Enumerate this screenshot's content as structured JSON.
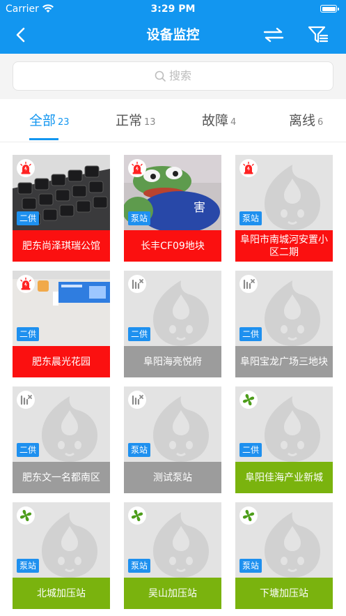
{
  "status_bar": {
    "carrier": "Carrier",
    "time": "3:29 PM"
  },
  "nav": {
    "title": "设备监控"
  },
  "search": {
    "placeholder": "搜索"
  },
  "tabs": [
    {
      "label": "全部",
      "count": "23"
    },
    {
      "label": "正常",
      "count": "13"
    },
    {
      "label": "故障",
      "count": "4"
    },
    {
      "label": "离线",
      "count": "6"
    }
  ],
  "colors": {
    "primary": "#1296f0",
    "alarm_red": "#fb1010",
    "offline_gray": "#9c9c9c",
    "normal_green": "#7ab30e",
    "badge_blue": "#1e90ef"
  },
  "devices": [
    {
      "name": "肥东尚泽琪瑞公馆",
      "type": "二供",
      "state": "alarm",
      "image": "keyboard-photo"
    },
    {
      "name": "长丰CF09地块",
      "type": "泵站",
      "state": "alarm",
      "image": "frog-plush-photo",
      "image_text": "害"
    },
    {
      "name": "阜阳市南城河安置小区二期",
      "type": "泵站",
      "state": "alarm",
      "image": "placeholder"
    },
    {
      "name": "肥东晨光花园",
      "type": "二供",
      "state": "alarm",
      "image": "screen-photo"
    },
    {
      "name": "阜阳海亮悦府",
      "type": "二供",
      "state": "offline",
      "image": "placeholder"
    },
    {
      "name": "阜阳宝龙广场三地块",
      "type": "二供",
      "state": "offline",
      "image": "placeholder"
    },
    {
      "name": "肥东文一名都南区",
      "type": "二供",
      "state": "offline",
      "image": "placeholder"
    },
    {
      "name": "测试泵站",
      "type": "泵站",
      "state": "offline",
      "image": "placeholder"
    },
    {
      "name": "阜阳佳海产业新城",
      "type": "二供",
      "state": "normal",
      "image": "placeholder"
    },
    {
      "name": "北城加压站",
      "type": "泵站",
      "state": "normal",
      "image": "placeholder"
    },
    {
      "name": "吴山加压站",
      "type": "泵站",
      "state": "normal",
      "image": "placeholder"
    },
    {
      "name": "下塘加压站",
      "type": "泵站",
      "state": "normal",
      "image": "placeholder"
    }
  ]
}
